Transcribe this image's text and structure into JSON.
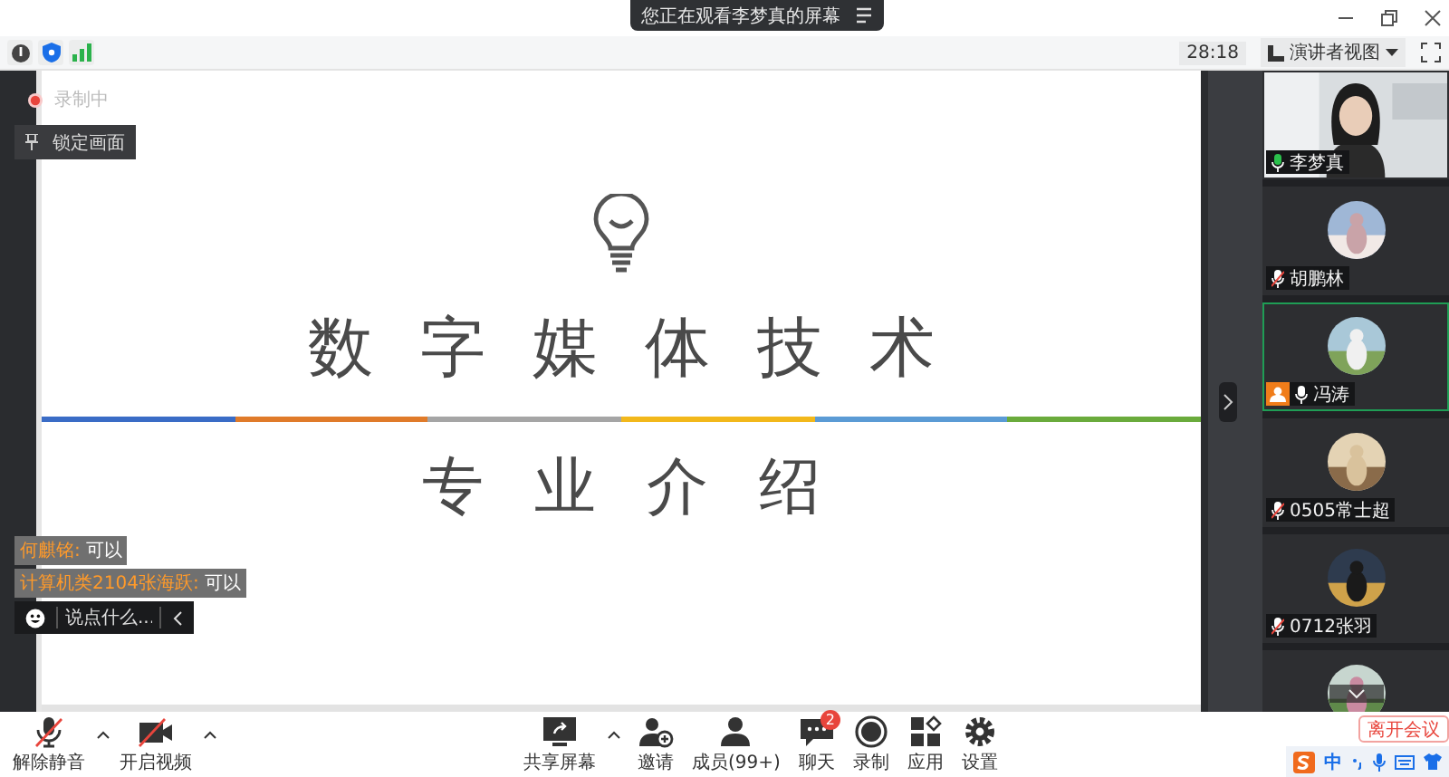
{
  "banner": {
    "text": "您正在观看李梦真的屏幕"
  },
  "meeting_bar": {
    "timer": "28:18",
    "view_button": "演讲者视图"
  },
  "recording": {
    "label": "录制中"
  },
  "pin_tooltip": {
    "label": "锁定画面"
  },
  "slide": {
    "title": "数字媒体技术",
    "subtitle": "专业介绍",
    "stripe": [
      {
        "color": "#3a6cc6"
      },
      {
        "color": "#e07b2a"
      },
      {
        "color": "#a5a5a5"
      },
      {
        "color": "#f2b81b"
      },
      {
        "color": "#5b9bd5"
      },
      {
        "color": "#6aab3c"
      }
    ]
  },
  "chat": {
    "messages": [
      {
        "sender": "何麒铭:",
        "text": "可以"
      },
      {
        "sender": "计算机类2104张海跃:",
        "text": "可以"
      }
    ],
    "placeholder": "说点什么..."
  },
  "participants": [
    {
      "name": "李梦真",
      "muted": false,
      "speaking": true,
      "host": false,
      "selected": false,
      "kind": "video"
    },
    {
      "name": "胡鹏林",
      "muted": true,
      "speaking": false,
      "host": false,
      "selected": false,
      "kind": "avatar"
    },
    {
      "name": "冯涛",
      "muted": false,
      "speaking": false,
      "host": true,
      "selected": true,
      "kind": "avatar"
    },
    {
      "name": "0505常士超",
      "muted": true,
      "speaking": false,
      "host": false,
      "selected": false,
      "kind": "avatar"
    },
    {
      "name": "0712张羽",
      "muted": true,
      "speaking": false,
      "host": false,
      "selected": false,
      "kind": "avatar"
    },
    {
      "selected": false,
      "kind": "avatar"
    }
  ],
  "controls": [
    {
      "label": "解除静音",
      "kind": "mic",
      "caret": true
    },
    {
      "label": "开启视频",
      "kind": "camera",
      "caret": true
    },
    {
      "label": "共享屏幕",
      "kind": "share",
      "caret": true
    },
    {
      "label": "邀请",
      "kind": "invite",
      "caret": false
    },
    {
      "label": "成员(99+)",
      "kind": "members",
      "caret": false
    },
    {
      "label": "聊天",
      "kind": "chat",
      "caret": false,
      "badge": "2"
    },
    {
      "label": "录制",
      "kind": "record",
      "caret": false
    },
    {
      "label": "应用",
      "kind": "apps",
      "caret": false
    },
    {
      "label": "设置",
      "kind": "settings",
      "caret": false
    }
  ],
  "leave_button": "离开会议",
  "ime": {
    "label": "中"
  }
}
